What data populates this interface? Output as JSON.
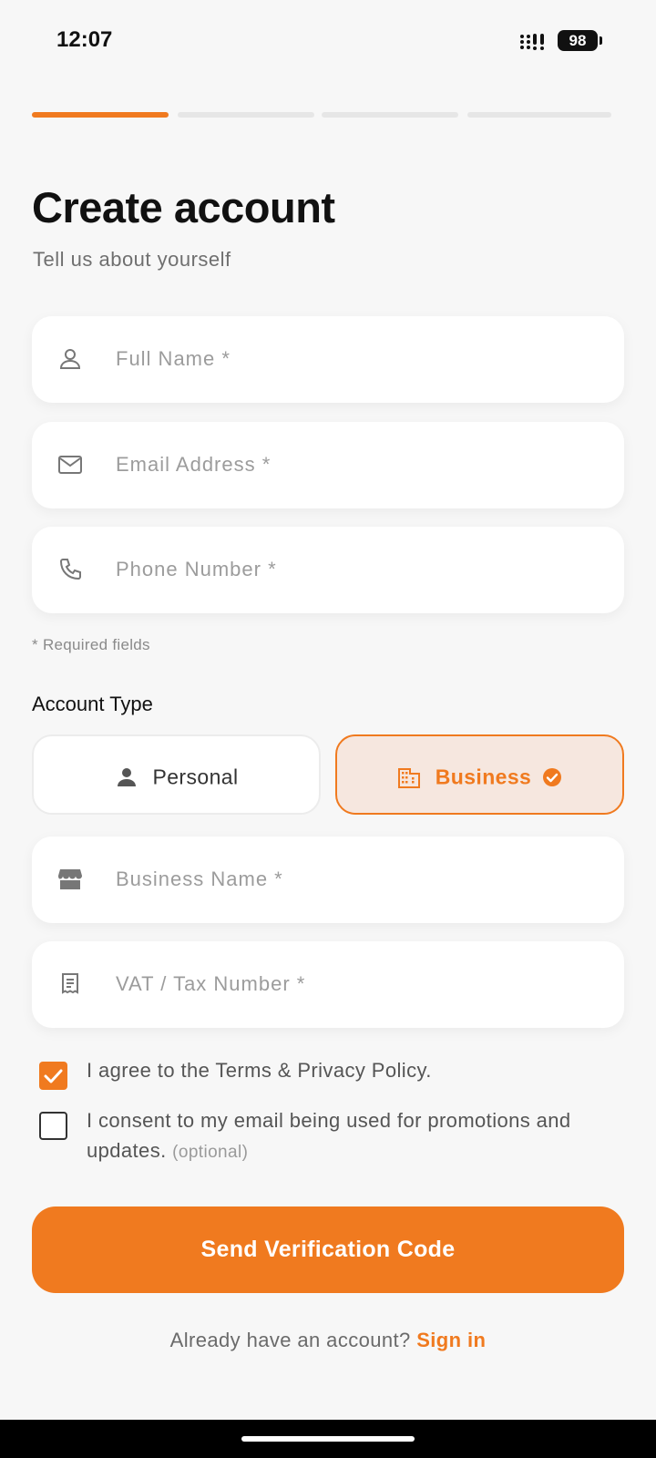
{
  "status_bar": {
    "time": "12:07",
    "battery": "98"
  },
  "progress": {
    "total_steps": 4,
    "current_step": 1
  },
  "header": {
    "title": "Create account",
    "subtitle": "Tell us about yourself"
  },
  "fields": {
    "full_name": {
      "placeholder": "Full Name *",
      "icon": "person-outline-icon"
    },
    "email": {
      "placeholder": "Email Address *",
      "icon": "mail-icon"
    },
    "phone": {
      "placeholder": "Phone Number *",
      "icon": "phone-icon"
    }
  },
  "required_hint": "* Required fields",
  "account_type": {
    "label": "Account Type",
    "options": [
      {
        "label": "Personal",
        "selected": false,
        "icon": "person-icon"
      },
      {
        "label": "Business",
        "selected": true,
        "icon": "building-icon"
      }
    ]
  },
  "business_fields": {
    "business_name": {
      "placeholder": "Business Name *",
      "icon": "storefront-icon"
    },
    "vat": {
      "placeholder": "VAT / Tax Number *",
      "icon": "receipt-icon"
    }
  },
  "consents": {
    "terms": {
      "text": "I agree to the Terms & Privacy Policy.",
      "checked": true
    },
    "marketing": {
      "text": "I consent to my email being used for promotions and updates.",
      "optional": "(optional)",
      "checked": false
    }
  },
  "primary_button": {
    "label": "Send Verification Code"
  },
  "footer": {
    "prompt": "Already have an account?",
    "link": "Sign in"
  },
  "colors": {
    "accent": "#f07a1f",
    "background": "#f7f7f7",
    "selected_bg": "#f6e7df"
  }
}
